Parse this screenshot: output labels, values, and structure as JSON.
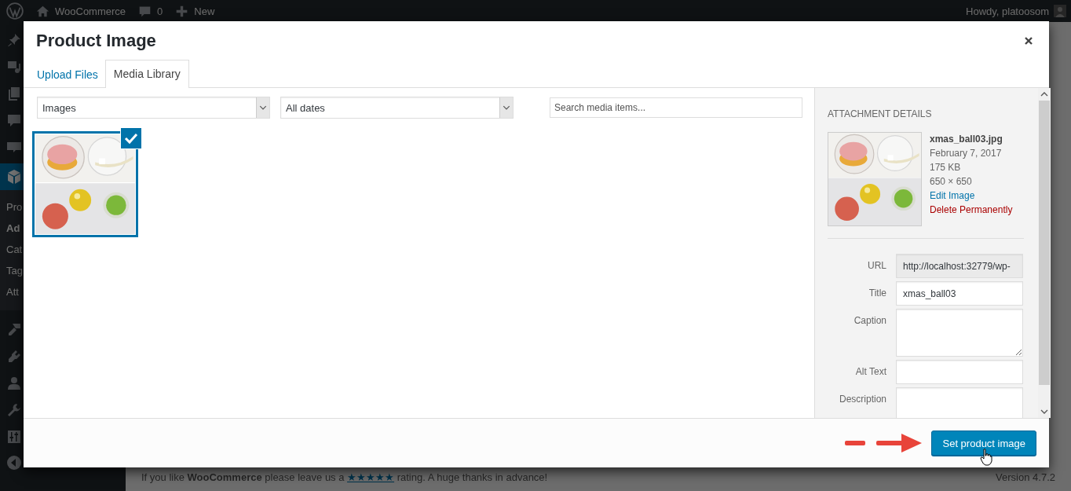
{
  "admin_bar": {
    "site": "WooCommerce",
    "comments": "0",
    "new": "New",
    "greeting": "Howdy, platoosom"
  },
  "sidebar": {
    "menu": [
      {
        "kind": "pin",
        "selected": false
      },
      {
        "kind": "media",
        "selected": false
      },
      {
        "kind": "pages",
        "selected": false
      },
      {
        "kind": "comments",
        "selected": false
      },
      {
        "kind": "woo",
        "selected": false
      },
      {
        "kind": "products",
        "selected": true
      }
    ],
    "submenu": [
      {
        "label": "Pro",
        "selected": false
      },
      {
        "label": "Ad",
        "selected": true
      },
      {
        "label": "Cat",
        "selected": false
      },
      {
        "label": "Tag",
        "selected": false
      },
      {
        "label": "Att",
        "selected": false
      }
    ],
    "menu_lower": [
      {
        "kind": "brush",
        "selected": false
      },
      {
        "kind": "plug",
        "selected": false
      },
      {
        "kind": "user",
        "selected": false
      },
      {
        "kind": "wrench",
        "selected": false
      },
      {
        "kind": "sliders",
        "selected": false
      }
    ]
  },
  "footer": {
    "text": "If you like **WooCommerce** please leave us a ",
    "link": "★★★★★",
    "text_after": " rating. A huge thanks in advance!",
    "version": "Version 4.7.2"
  },
  "modal": {
    "title": "Product Image",
    "tabs": [
      {
        "label": "Upload Files",
        "selected": false
      },
      {
        "label": "Media Library",
        "selected": true
      }
    ],
    "filters": {
      "type": "Images",
      "date": "All dates",
      "search_placeholder": "Search media items..."
    },
    "attachments": [
      {
        "kind": "picture",
        "selected": true
      }
    ],
    "details": {
      "heading": "ATTACHMENT DETAILS",
      "filename": "xmas_ball03.jpg",
      "date": "February 7, 2017",
      "size": "175 KB",
      "dimensions": "650 × 650",
      "edit_link": "Edit Image",
      "delete_link": "Delete Permanently",
      "fields": [
        {
          "label": "URL",
          "kind": "readonly",
          "value": "http://localhost:32779/wp-"
        },
        {
          "label": "Title",
          "kind": "text",
          "value": "xmas_ball03"
        },
        {
          "label": "Caption",
          "kind": "textarea"
        },
        {
          "label": "Alt Text",
          "kind": "text"
        },
        {
          "label": "Description",
          "kind": "textarea"
        }
      ]
    },
    "button": "Set product image"
  }
}
